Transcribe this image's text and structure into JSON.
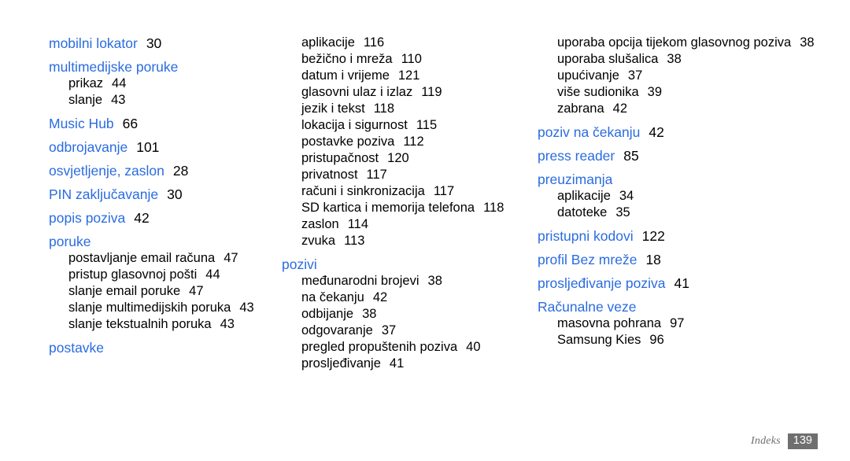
{
  "document": {
    "type": "index-page",
    "language": "hr",
    "colors": {
      "entry_blue": "#2a6ce0",
      "page_number_black": "#000000",
      "footer_gray": "#6f6f6f",
      "background": "#ffffff"
    }
  },
  "footer": {
    "label": "Indeks",
    "page_number": "139"
  },
  "columns": [
    {
      "id": "column-1",
      "groups": [
        {
          "head": "mobilni lokator",
          "head_page": "30",
          "subs": []
        },
        {
          "head": "multimedijske poruke",
          "head_page": "",
          "subs": [
            {
              "text": "prikaz",
              "page": "44"
            },
            {
              "text": "slanje",
              "page": "43"
            }
          ]
        },
        {
          "head": "Music Hub",
          "head_page": "66",
          "subs": []
        },
        {
          "head": "odbrojavanje",
          "head_page": "101",
          "subs": []
        },
        {
          "head": "osvjetljenje, zaslon",
          "head_page": "28",
          "subs": []
        },
        {
          "head": "PIN zaključavanje",
          "head_page": "30",
          "subs": []
        },
        {
          "head": "popis poziva",
          "head_page": "42",
          "subs": []
        },
        {
          "head": "poruke",
          "head_page": "",
          "subs": [
            {
              "text": "postavljanje email računa",
              "page": "47"
            },
            {
              "text": "pristup glasovnoj pošti",
              "page": "44"
            },
            {
              "text": "slanje email poruke",
              "page": "47"
            },
            {
              "text": "slanje multimedijskih poruka",
              "page": "43"
            },
            {
              "text": "slanje tekstualnih poruka",
              "page": "43"
            }
          ]
        },
        {
          "head": "postavke",
          "head_page": "",
          "subs": []
        }
      ]
    },
    {
      "id": "column-2",
      "groups": [
        {
          "head": "",
          "head_page": "",
          "subs": [
            {
              "text": "aplikacije",
              "page": "116"
            },
            {
              "text": "bežično i mreža",
              "page": "110"
            },
            {
              "text": "datum i vrijeme",
              "page": "121"
            },
            {
              "text": "glasovni ulaz i izlaz",
              "page": "119"
            },
            {
              "text": "jezik i tekst",
              "page": "118"
            },
            {
              "text": "lokacija i sigurnost",
              "page": "115"
            },
            {
              "text": "postavke poziva",
              "page": "112"
            },
            {
              "text": "pristupačnost",
              "page": "120"
            },
            {
              "text": "privatnost",
              "page": "117"
            },
            {
              "text": "računi i sinkronizacija",
              "page": "117"
            },
            {
              "text": "SD kartica i memorija telefona",
              "page": "118"
            },
            {
              "text": "zaslon",
              "page": "114"
            },
            {
              "text": "zvuka",
              "page": "113"
            }
          ]
        },
        {
          "head": "pozivi",
          "head_page": "",
          "subs": [
            {
              "text": "međunarodni brojevi",
              "page": "38"
            },
            {
              "text": "na čekanju",
              "page": "42"
            },
            {
              "text": "odbijanje",
              "page": "38"
            },
            {
              "text": "odgovaranje",
              "page": "37"
            },
            {
              "text": "pregled propuštenih poziva",
              "page": "40"
            },
            {
              "text": "prosljeđivanje",
              "page": "41"
            }
          ]
        }
      ]
    },
    {
      "id": "column-3",
      "groups": [
        {
          "head": "",
          "head_page": "",
          "subs": [
            {
              "text": "uporaba opcija tijekom glasovnog poziva",
              "page": "38",
              "wrap": true
            },
            {
              "text": "uporaba slušalica",
              "page": "38"
            },
            {
              "text": "upućivanje",
              "page": "37"
            },
            {
              "text": "više sudionika",
              "page": "39"
            },
            {
              "text": "zabrana",
              "page": "42"
            }
          ]
        },
        {
          "head": "poziv na čekanju",
          "head_page": "42",
          "subs": []
        },
        {
          "head": "press reader",
          "head_page": "85",
          "subs": []
        },
        {
          "head": "preuzimanja",
          "head_page": "",
          "subs": [
            {
              "text": "aplikacije",
              "page": "34"
            },
            {
              "text": "datoteke",
              "page": "35"
            }
          ]
        },
        {
          "head": "pristupni kodovi",
          "head_page": "122",
          "subs": []
        },
        {
          "head": "profil Bez mreže",
          "head_page": "18",
          "subs": []
        },
        {
          "head": "prosljeđivanje poziva",
          "head_page": "41",
          "subs": []
        },
        {
          "head": "Računalne veze",
          "head_page": "",
          "subs": [
            {
              "text": "masovna pohrana",
              "page": "97"
            },
            {
              "text": "Samsung Kies",
              "page": "96"
            }
          ]
        }
      ]
    }
  ]
}
